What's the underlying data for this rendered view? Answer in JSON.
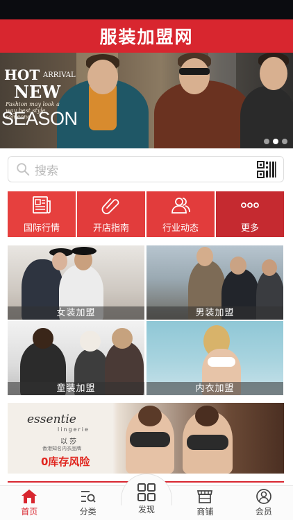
{
  "header": {
    "title": "服装加盟网"
  },
  "banner": {
    "text_hot": "HOT",
    "text_arrival": "ARRIVAL",
    "text_new": "NEW",
    "text_script": "Fashion may look a way best style someone",
    "text_season": "SEASON",
    "slides": 3,
    "active_slide": 2
  },
  "search": {
    "placeholder": "搜索"
  },
  "quick_links": [
    {
      "label": "国际行情",
      "icon": "newspaper-icon"
    },
    {
      "label": "开店指南",
      "icon": "paperclip-icon"
    },
    {
      "label": "行业动态",
      "icon": "users-icon"
    },
    {
      "label": "更多",
      "icon": "more-dots-icon"
    }
  ],
  "categories": [
    {
      "label": "女装加盟"
    },
    {
      "label": "男装加盟"
    },
    {
      "label": "童装加盟"
    },
    {
      "label": "内衣加盟"
    }
  ],
  "ad": {
    "brand": "essentie",
    "brand_sub": "lingerie",
    "name": "以 莎",
    "desc": "香港知名内衣品牌",
    "promo": "0库存风险"
  },
  "tabbar": [
    {
      "label": "首页",
      "icon": "home-icon",
      "active": true
    },
    {
      "label": "分类",
      "icon": "category-search-icon",
      "active": false
    },
    {
      "label": "发现",
      "icon": "grid-icon",
      "active": false
    },
    {
      "label": "商铺",
      "icon": "shop-icon",
      "active": false
    },
    {
      "label": "会员",
      "icon": "user-icon",
      "active": false
    }
  ],
  "colors": {
    "brand_red": "#d8262f",
    "quick_red": "#e23c3c"
  }
}
